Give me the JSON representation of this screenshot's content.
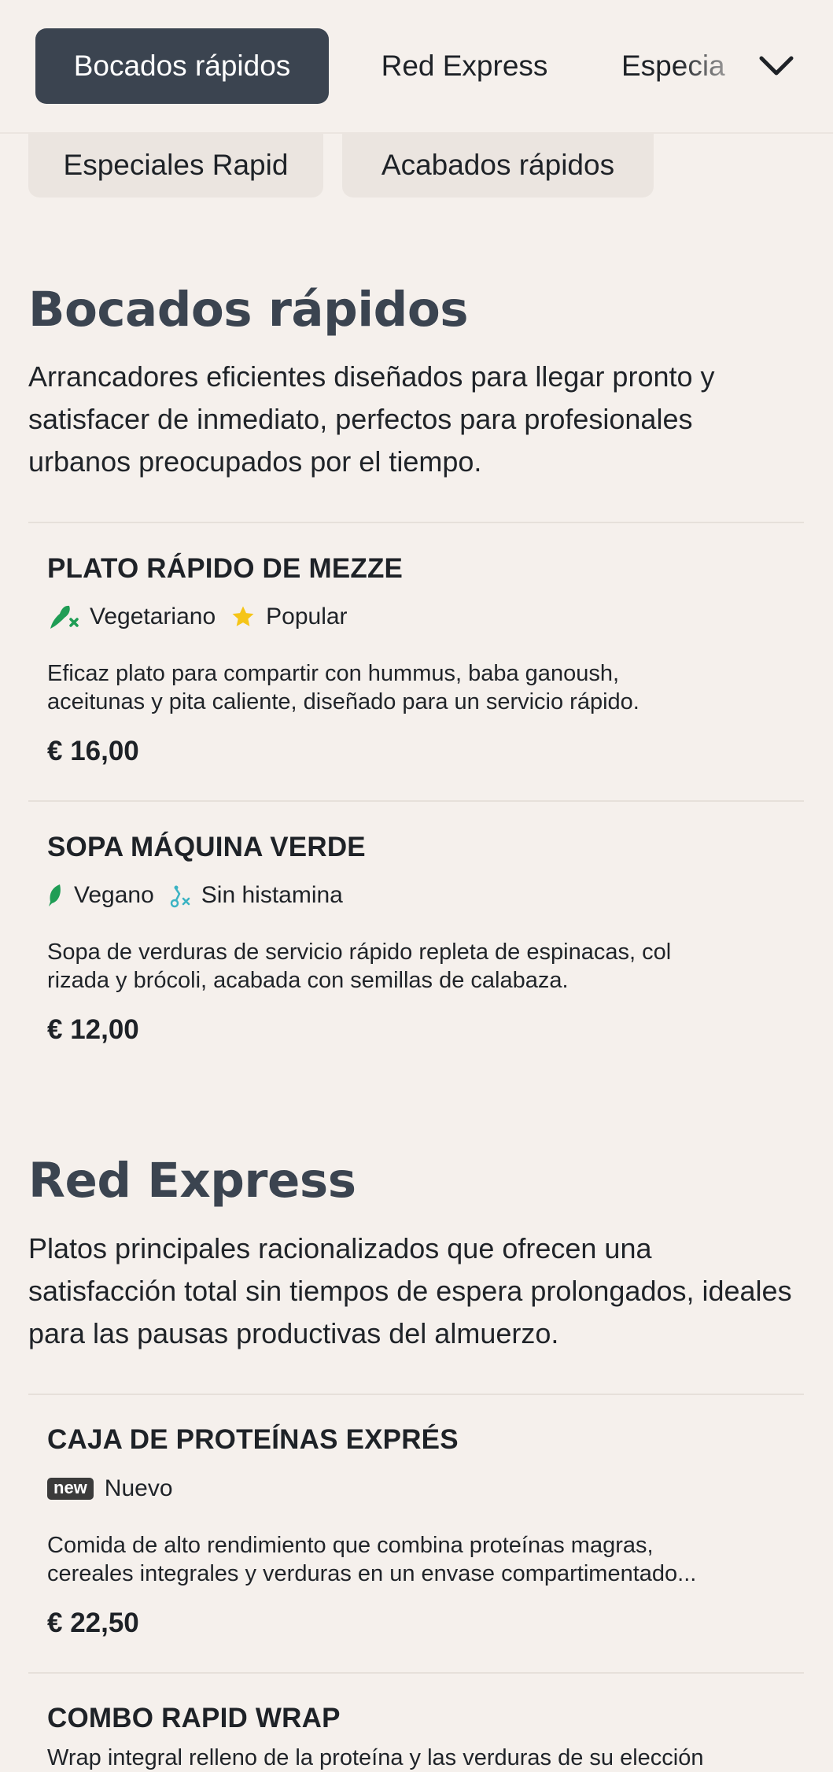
{
  "nav": {
    "tabs": [
      {
        "label": "Bocados rápidos"
      },
      {
        "label": "Red Express"
      },
      {
        "label": "Especia"
      }
    ],
    "more_icon": "chevron-down-icon",
    "pills": [
      {
        "label": "Especiales Rapid"
      },
      {
        "label": "Acabados rápidos"
      }
    ]
  },
  "sections": [
    {
      "title": "Bocados rápidos",
      "description": "Arrancadores eficientes diseñados para llegar pronto y satisfacer de inmediato, perfectos para profesionales urbanos preocupados por el tiempo.",
      "items": [
        {
          "name": "PLATO RÁPIDO DE MEZZE",
          "tags": [
            {
              "label": "Vegetariano",
              "icon": "vegetarian-icon",
              "color": "#1f9d55"
            },
            {
              "label": "Popular",
              "icon": "star-icon",
              "color": "#f5c518"
            }
          ],
          "desc_lines": [
            "Eficaz plato para compartir con hummus, baba ganoush,",
            "aceitunas y pita caliente, diseñado para un servicio rápido."
          ],
          "price": "€ 16,00"
        },
        {
          "name": "SOPA MÁQUINA VERDE",
          "tags": [
            {
              "label": "Vegano",
              "icon": "leaf-icon",
              "color": "#1f9d55"
            },
            {
              "label": "Sin histamina",
              "icon": "histamine-free-icon",
              "color": "#3bb3c3"
            }
          ],
          "desc_lines": [
            "Sopa de verduras de servicio rápido repleta de espinacas, col",
            "rizada y brócoli, acabada con semillas de calabaza."
          ],
          "price": "€ 12,00"
        }
      ]
    },
    {
      "title": "Red Express",
      "description": "Platos principales racionalizados que ofrecen una satisfacción total sin tiempos de espera prolongados, ideales para las pausas productivas del almuerzo.",
      "items": [
        {
          "name": "CAJA DE PROTEÍNAS EXPRÉS",
          "tags": [
            {
              "label": "Nuevo",
              "badge": "new"
            }
          ],
          "desc_lines": [
            "Comida de alto rendimiento que combina proteínas magras,",
            "cereales integrales y verduras en un envase compartimentado..."
          ],
          "price": "€ 22,50"
        },
        {
          "name": "COMBO RAPID WRAP",
          "desc_lines": [
            "Wrap integral relleno de la proteína y las verduras de su elección"
          ]
        }
      ]
    }
  ]
}
